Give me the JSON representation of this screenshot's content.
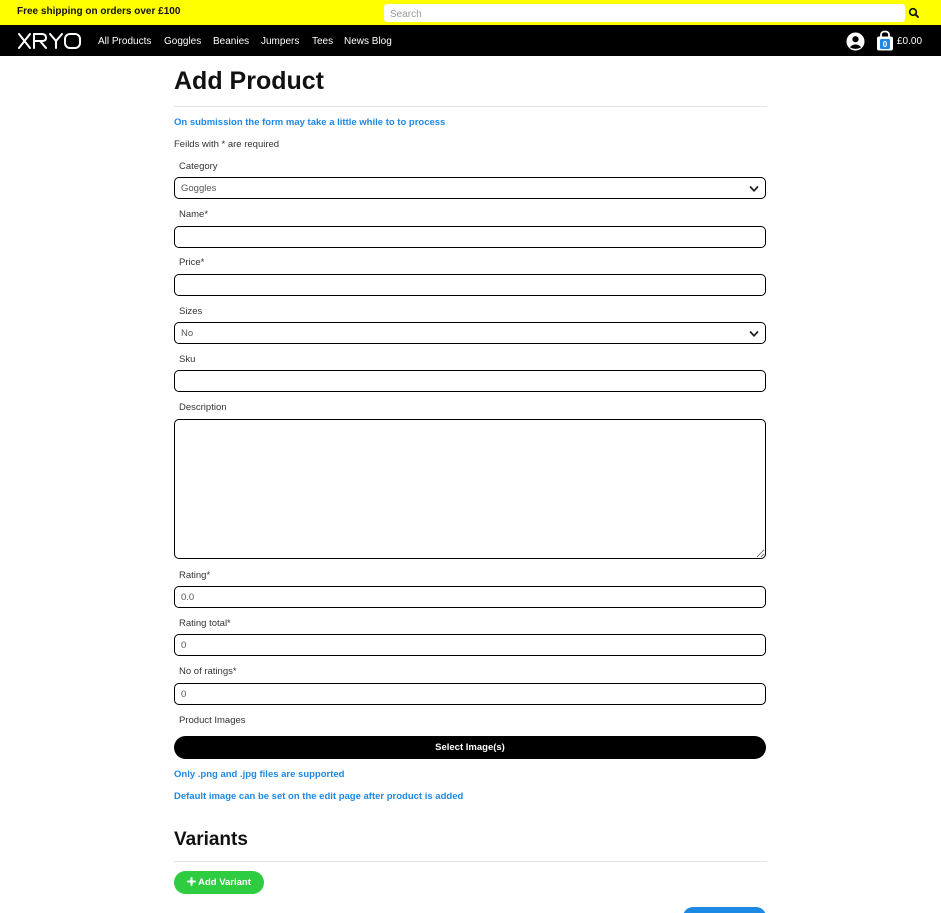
{
  "topbar": {
    "shipping_text": "Free shipping on orders over £100",
    "search_placeholder": "Search",
    "search_icon": "search-icon"
  },
  "navbar": {
    "logo_text": "XRYO",
    "links": [
      "All Products",
      "Goggles",
      "Beanies",
      "Jumpers",
      "Tees",
      "News Blog"
    ],
    "cart_count": "0",
    "cart_total": "£0.00"
  },
  "page": {
    "title": "Add Product",
    "submit_notice": "On submission the form may take a little while to to process",
    "required_note": "Feilds with * are required"
  },
  "form": {
    "category_label": "Category",
    "category_value": "Goggles",
    "name_label": "Name*",
    "price_label": "Price*",
    "sizes_label": "Sizes",
    "sizes_value": "No",
    "sku_label": "Sku",
    "description_label": "Description",
    "rating_label": "Rating*",
    "rating_value": "0.0",
    "rating_total_label": "Rating total*",
    "rating_total_value": "0",
    "num_ratings_label": "No of ratings*",
    "num_ratings_value": "0",
    "images_label": "Product Images",
    "select_images_label": "Select Image(s)",
    "file_types_note": "Only .png and .jpg files are supported",
    "default_image_note": "Default image can be set on the edit page after product is added"
  },
  "variants": {
    "title": "Variants",
    "add_label": "Add Variant"
  },
  "colors": {
    "topbar": "#ffff00",
    "navbar": "#000000",
    "info_blue": "#1e88e5",
    "add_green": "#2ecc40"
  }
}
